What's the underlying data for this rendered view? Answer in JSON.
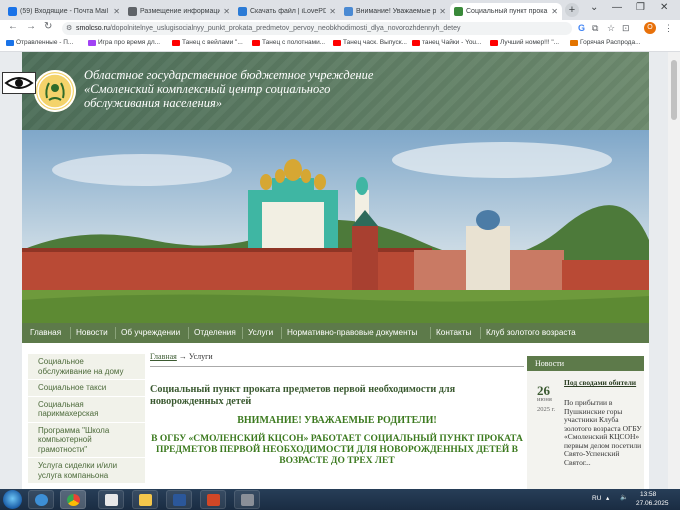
{
  "browser": {
    "tabs": [
      {
        "title": "(59) Входящие - Почта Mail",
        "favicon_color": "#1a73e8",
        "active": false
      },
      {
        "title": "Размещение информации",
        "favicon_color": "#5f6368",
        "active": false
      },
      {
        "title": "Скачать файл | iLovePDF",
        "favicon_color": "#2b7bd6",
        "active": false
      },
      {
        "title": "Внимание! Уважаемые ро",
        "favicon_color": "#4a8ad3",
        "active": false
      },
      {
        "title": "Социальный пункт прока",
        "favicon_color": "#3a8a3a",
        "active": true
      }
    ],
    "new_tab": "+",
    "address": {
      "host": "smolcso.ru",
      "path": "/dopolnitelnye_uslugisocialnyy_punkt_prokata_predmetov_pervoy_neobkhodimosti_dlya_novorozhdennyh_detey"
    },
    "profile_initial": "O",
    "bookmarks": [
      {
        "label": "Отравленные - П...",
        "color": "#1a73e8"
      },
      {
        "label": "Игра про время дл...",
        "color": "#a142f4"
      },
      {
        "label": "Танец с вейлами \"...",
        "color": "#ff0000"
      },
      {
        "label": "Танец с полотнами...",
        "color": "#ff0000"
      },
      {
        "label": "Танец часк. Выпуск...",
        "color": "#ff0000"
      },
      {
        "label": "танец Чайки - You...",
        "color": "#ff0000"
      },
      {
        "label": "Лучший номер!!! \"...",
        "color": "#ff0000"
      },
      {
        "label": "Горячая Распрода...",
        "color": "#e37400"
      }
    ]
  },
  "site": {
    "title_line1": "Областное государственное бюджетное учреждение",
    "title_line2": "«Смоленский комплексный центр социального",
    "title_line3": "обслуживания населения»",
    "menu": [
      "Главная",
      "Новости",
      "Об учреждении",
      "Отделения",
      "Услуги",
      "Нормативно-правовые документы",
      "Контакты",
      "Клуб золотого возраста"
    ],
    "sidebar": [
      "Социальное обслуживание на дому",
      "Социальное такси",
      "Социальная парикмахерская",
      "Программа \"Школа компьютерной грамотности\"",
      "Услуга сиделки и/или услуга компаньона"
    ],
    "breadcrumb_home": "Главная",
    "breadcrumb_sep": "→",
    "breadcrumb_current": "Услуги",
    "heading": "Социальный пункт проката предметов первой необходимости для новорожденных детей",
    "notice": "ВНИМАНИЕ! УВАЖАЕМЫЕ РОДИТЕЛИ!",
    "body_text": "В ОГБУ «СМОЛЕНСКИЙ КЦСОН» РАБОТАЕТ СОЦИАЛЬНЫЙ ПУНКТ ПРОКАТА ПРЕДМЕТОВ ПЕРВОЙ НЕОБХОДИМОСТИ ДЛЯ НОВОРОЖДЕННЫХ ДЕТЕЙ В ВОЗРАСТЕ ДО ТРЕХ ЛЕТ",
    "news": {
      "header": "Новости",
      "day": "26",
      "month": "июня",
      "year": "2025 г.",
      "title": "Под сводами обители",
      "text": "По прибытии в Пушкинские горы участники Клуба золотого возраста ОГБУ «Смоленский КЦСОН» первым делом посетили Свято-Успенский Святог..."
    }
  },
  "taskbar": {
    "language": "RU",
    "time": "13:58",
    "date": "27.06.2025"
  }
}
